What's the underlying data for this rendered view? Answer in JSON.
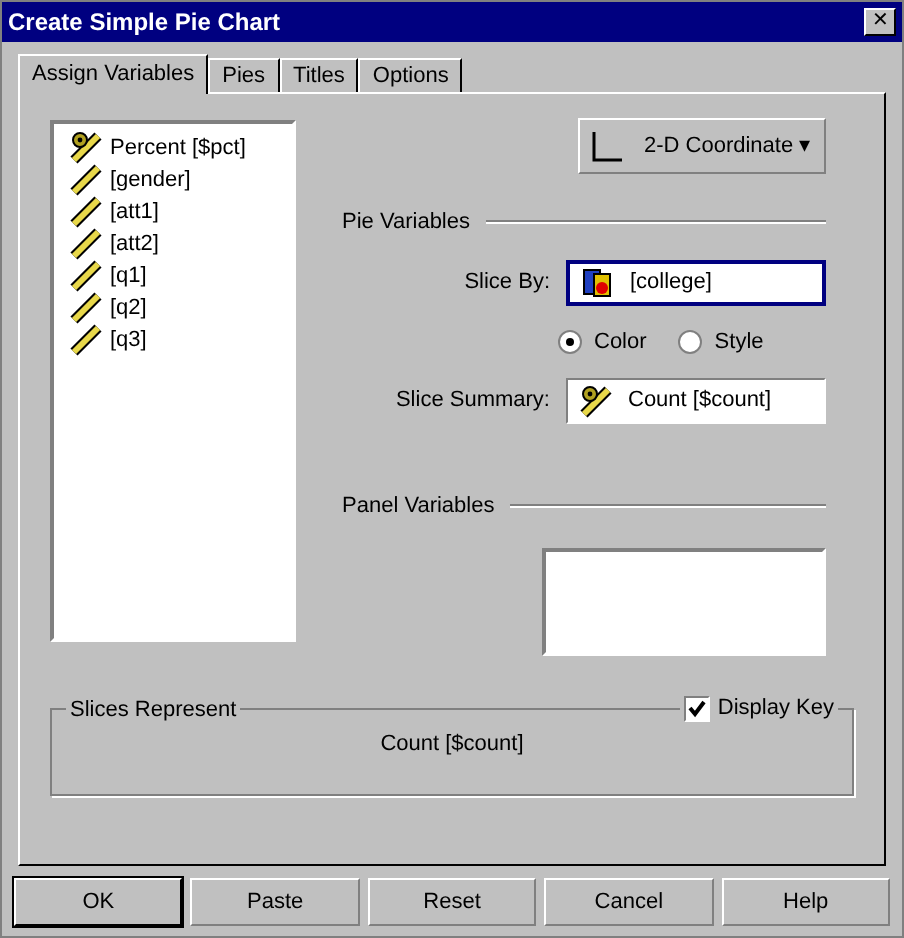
{
  "window": {
    "title": "Create Simple Pie Chart",
    "close": "✕"
  },
  "tabs": [
    {
      "label": "Assign Variables",
      "selected": true
    },
    {
      "label": "Pies",
      "selected": false
    },
    {
      "label": "Titles",
      "selected": false
    },
    {
      "label": "Options",
      "selected": false
    }
  ],
  "variables": [
    {
      "kind": "summary",
      "label": "Percent [$pct]"
    },
    {
      "kind": "scale",
      "label": "[gender]"
    },
    {
      "kind": "scale",
      "label": "[att1]"
    },
    {
      "kind": "scale",
      "label": "[att2]"
    },
    {
      "kind": "scale",
      "label": "[q1]"
    },
    {
      "kind": "scale",
      "label": "[q2]"
    },
    {
      "kind": "scale",
      "label": "[q3]"
    }
  ],
  "coordinate_button": {
    "label": "2-D Coordinate",
    "caret": "▾"
  },
  "pie_variables": {
    "heading": "Pie Variables",
    "slice_by_label": "Slice By:",
    "slice_by_value": "[college]",
    "options": [
      {
        "label": "Color",
        "selected": true
      },
      {
        "label": "Style",
        "selected": false
      }
    ],
    "slice_summary_label": "Slice Summary:",
    "slice_summary_value": "Count [$count]"
  },
  "panel_variables": {
    "heading": "Panel Variables"
  },
  "slices_represent": {
    "heading": "Slices Represent",
    "value": "Count [$count]",
    "display_key": {
      "label": "Display Key",
      "checked": true
    }
  },
  "buttons": [
    {
      "label": "OK",
      "default": true
    },
    {
      "label": "Paste",
      "default": false
    },
    {
      "label": "Reset",
      "default": false
    },
    {
      "label": "Cancel",
      "default": false
    },
    {
      "label": "Help",
      "default": false
    }
  ]
}
